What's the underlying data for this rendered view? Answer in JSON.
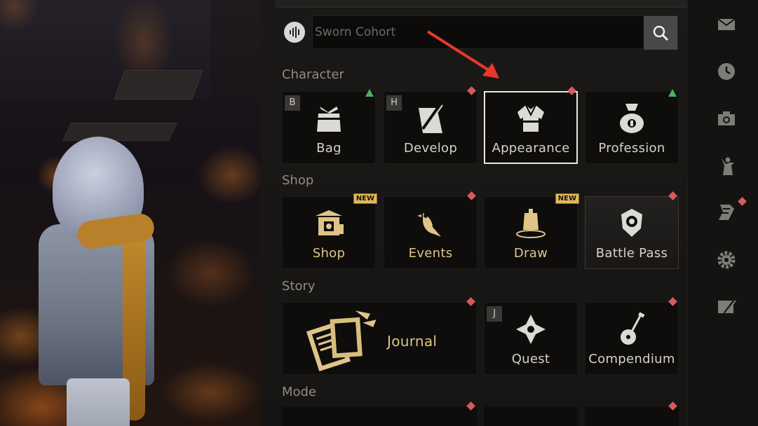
{
  "search": {
    "placeholder": "Sworn Cohort"
  },
  "sections": {
    "character": "Character",
    "shop": "Shop",
    "story": "Story",
    "mode": "Mode"
  },
  "character_tiles": [
    {
      "label": "Bag",
      "hotkey": "B",
      "icon": "bag-icon",
      "marker": "green-up-arrow"
    },
    {
      "label": "Develop",
      "hotkey": "H",
      "icon": "develop-icon",
      "marker": "red-dot"
    },
    {
      "label": "Appearance",
      "icon": "robe-icon",
      "marker": "red-dot",
      "selected": true
    },
    {
      "label": "Profession",
      "icon": "money-bag-icon",
      "marker": "green-up-arrow"
    }
  ],
  "shop_tiles": [
    {
      "label": "Shop",
      "icon": "shop-building-icon",
      "badge": "NEW"
    },
    {
      "label": "Events",
      "icon": "bird-icon",
      "marker": "red-dot"
    },
    {
      "label": "Draw",
      "icon": "bell-icon",
      "badge": "NEW"
    },
    {
      "label": "Battle Pass",
      "icon": "shield-badge-icon",
      "marker": "red-dot"
    }
  ],
  "story_tiles": [
    {
      "label": "Journal",
      "icon": "scrolls-icon",
      "marker": "red-dot"
    },
    {
      "label": "Quest",
      "hotkey": "J",
      "icon": "quest-flower-icon"
    },
    {
      "label": "Compendium",
      "icon": "lute-icon",
      "marker": "red-dot"
    }
  ],
  "badges": {
    "new": "NEW"
  },
  "hotkeys": {
    "bag": "B",
    "develop": "H",
    "quest": "J"
  },
  "sidebar_icons": [
    "mail-icon",
    "clock-icon",
    "camera-icon",
    "gesture-icon",
    "scroll-icon",
    "gear-icon",
    "edit-card-icon"
  ],
  "colors": {
    "marker_red": "#d85a5a",
    "marker_green": "#4caf60",
    "badge_gold": "#e3b95d",
    "journal_gold": "#e0c487",
    "annotation_arrow": "#e8382c"
  }
}
